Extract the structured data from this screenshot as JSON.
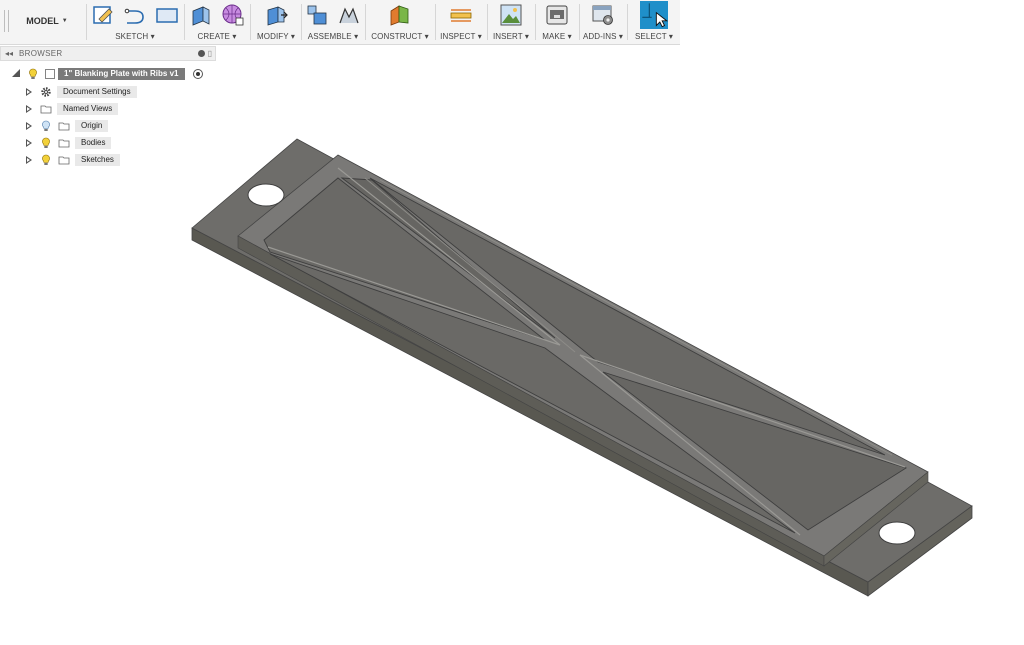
{
  "toolbar": {
    "mode_label": "MODEL",
    "groups": [
      {
        "label": "SKETCH",
        "icons": [
          "sketch-create-icon",
          "line-icon",
          "rectangle-icon"
        ]
      },
      {
        "label": "CREATE",
        "icons": [
          "extrude-icon",
          "form-icon"
        ]
      },
      {
        "label": "MODIFY",
        "icons": [
          "press-pull-icon"
        ]
      },
      {
        "label": "ASSEMBLE",
        "icons": [
          "new-component-icon",
          "joint-icon"
        ]
      },
      {
        "label": "CONSTRUCT",
        "icons": [
          "plane-icon"
        ]
      },
      {
        "label": "INSPECT",
        "icons": [
          "measure-icon"
        ]
      },
      {
        "label": "INSERT",
        "icons": [
          "insert-image-icon"
        ]
      },
      {
        "label": "MAKE",
        "icons": [
          "3d-print-icon"
        ]
      },
      {
        "label": "ADD-INS",
        "icons": [
          "scripts-icon"
        ]
      },
      {
        "label": "SELECT",
        "icons": [
          "select-icon"
        ]
      }
    ],
    "dropdown_glyph": "▾"
  },
  "browser": {
    "title": "BROWSER",
    "collapse_glyph": "◂◂",
    "root": {
      "label": "1\" Blanking Plate with Ribs v1"
    },
    "items": [
      {
        "label": "Document Settings",
        "icon": "gear-icon"
      },
      {
        "label": "Named Views",
        "icon": "folder-icon"
      },
      {
        "label": "Origin",
        "icon": "folder-icon",
        "bulb": "lightbulb-off-icon"
      },
      {
        "label": "Bodies",
        "icon": "folder-icon",
        "bulb": "lightbulb-on-icon"
      },
      {
        "label": "Sketches",
        "icon": "folder-icon",
        "bulb": "lightbulb-on-icon"
      }
    ]
  },
  "colors": {
    "accent_select": "#1f8fc9",
    "plate_top": "#6d6c6a",
    "plate_side": "#5b5950",
    "rib": "#888885",
    "background": "#ffffff"
  }
}
